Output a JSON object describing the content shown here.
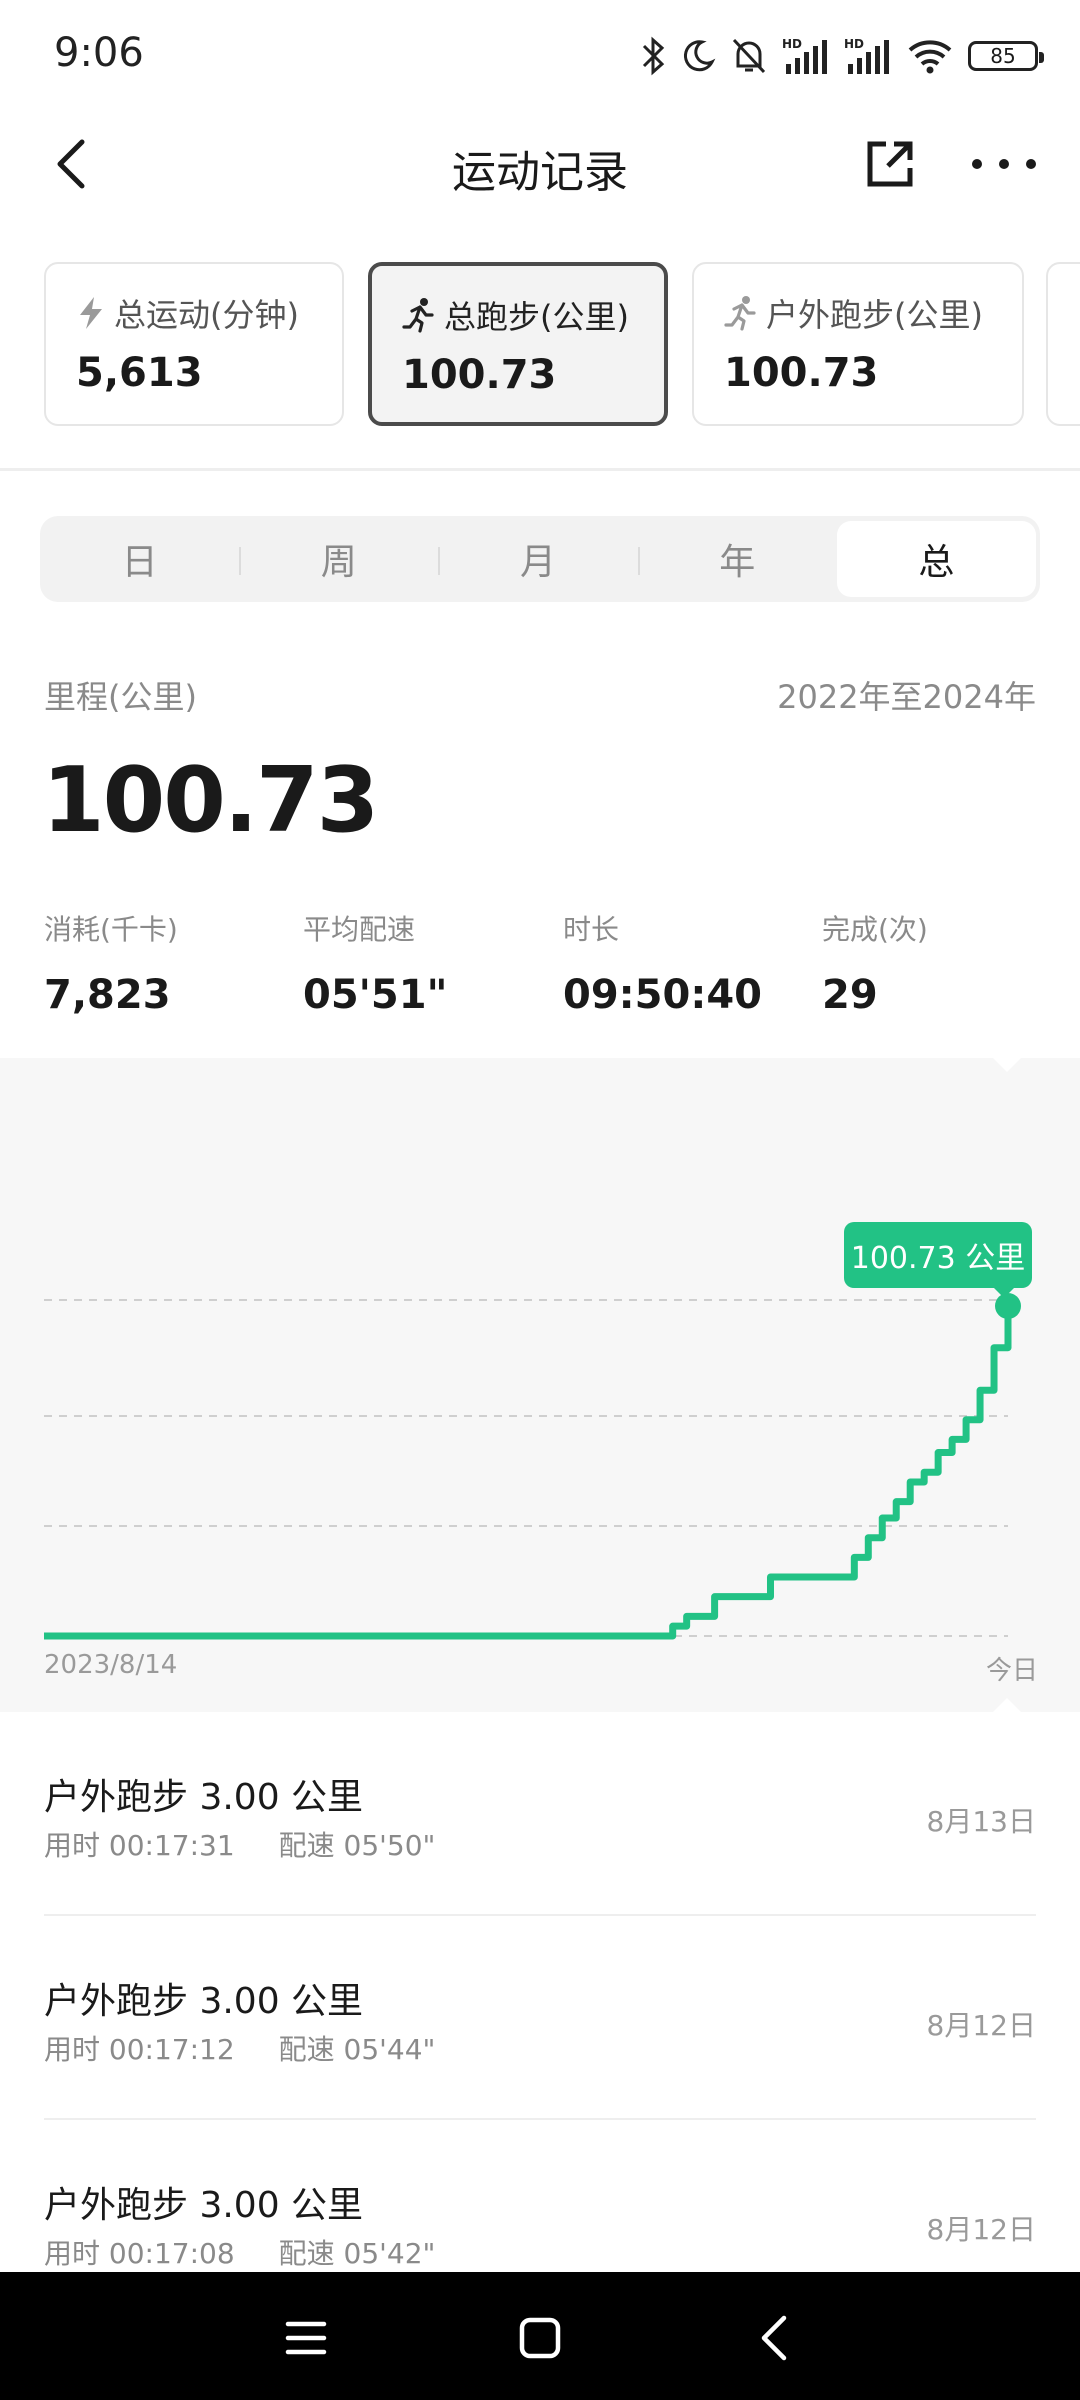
{
  "status_bar": {
    "time": "9:06",
    "battery": "85",
    "icons": [
      "bluetooth-icon",
      "moon-icon",
      "bell-off-icon",
      "signal-hd-icon",
      "signal-hd-icon",
      "wifi-icon",
      "battery-icon"
    ]
  },
  "header": {
    "title": "运动记录",
    "back_icon": "chevron-left-icon",
    "share_icon": "external-link-icon",
    "more_icon": "more-dots-icon"
  },
  "cards": [
    {
      "icon": "lightning-icon",
      "label": "总运动(分钟)",
      "value": "5,613"
    },
    {
      "icon": "running-icon",
      "label": "总跑步(公里)",
      "value": "100.73",
      "active": true
    },
    {
      "icon": "running-icon",
      "label": "户外跑步(公里)",
      "value": "100.73"
    }
  ],
  "segment": {
    "items": [
      "日",
      "周",
      "月",
      "年",
      "总"
    ],
    "selected": "总"
  },
  "summary": {
    "label": "里程(公里)",
    "range": "2022年至2024年",
    "value": "100.73",
    "metrics": [
      {
        "label": "消耗(千卡)",
        "value": "7,823"
      },
      {
        "label": "平均配速",
        "value": "05'51\""
      },
      {
        "label": "时长",
        "value": "09:50:40"
      },
      {
        "label": "完成(次)",
        "value": "29"
      }
    ]
  },
  "chart_data": {
    "type": "line",
    "x_start_label": "2023/8/14",
    "x_end_label": "今日",
    "tooltip": "100.73 公里",
    "y_max": 100.73,
    "grid": true,
    "color": "#22c285",
    "series": [
      {
        "values": [
          0,
          0,
          0,
          0,
          0,
          0,
          0,
          0,
          0,
          0,
          0,
          0,
          0,
          0,
          0,
          0,
          0,
          0,
          0,
          0,
          0,
          0,
          0,
          0,
          0,
          0,
          0,
          0,
          0,
          0,
          0,
          0,
          0,
          0,
          0,
          0,
          0,
          0,
          0,
          0,
          0,
          0,
          0,
          0,
          0,
          3,
          6,
          6,
          12,
          12,
          12,
          12,
          18,
          18,
          18,
          18,
          18,
          18,
          24,
          30,
          36,
          41,
          47,
          50,
          56,
          60,
          66,
          75,
          88,
          100.73
        ]
      }
    ]
  },
  "records": [
    {
      "title": "户外跑步 3.00 公里",
      "duration": "用时 00:17:31",
      "pace": "配速 05'50\"",
      "date": "8月13日"
    },
    {
      "title": "户外跑步 3.00 公里",
      "duration": "用时 00:17:12",
      "pace": "配速 05'44\"",
      "date": "8月12日"
    },
    {
      "title": "户外跑步 3.00 公里",
      "duration": "用时 00:17:08",
      "pace": "配速 05'42\"",
      "date": "8月12日"
    }
  ],
  "nav_bar": {
    "icons": [
      "menu-icon",
      "home-square-icon",
      "back-triangle-icon"
    ]
  }
}
